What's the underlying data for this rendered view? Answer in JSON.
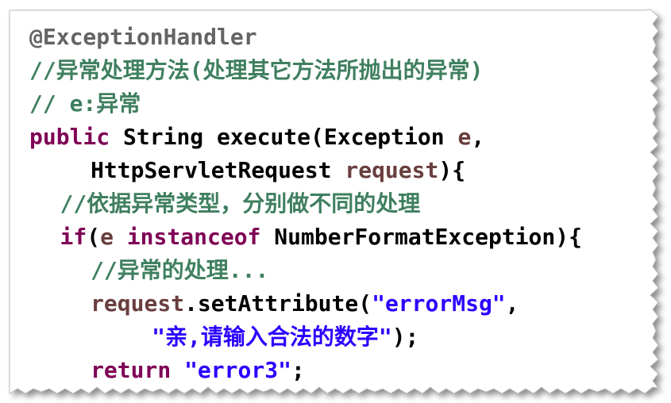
{
  "code": {
    "lines": [
      {
        "indent": 0,
        "tokens": [
          {
            "t": "@ExceptionHandler",
            "c": "annotation"
          }
        ]
      },
      {
        "indent": 0,
        "tokens": [
          {
            "t": "//异常处理方法(处理其它方法所抛出的异常)",
            "c": "comment"
          }
        ]
      },
      {
        "indent": 0,
        "tokens": [
          {
            "t": "// e:异常",
            "c": "comment"
          }
        ]
      },
      {
        "indent": 0,
        "tokens": [
          {
            "t": "public",
            "c": "keyword"
          },
          {
            "t": " String execute(Exception ",
            "c": "type"
          },
          {
            "t": "e",
            "c": "param"
          },
          {
            "t": ",",
            "c": "plain"
          }
        ]
      },
      {
        "indent": 4,
        "tokens": [
          {
            "t": "HttpServletRequest ",
            "c": "type"
          },
          {
            "t": "request",
            "c": "param"
          },
          {
            "t": "){",
            "c": "plain"
          }
        ]
      },
      {
        "indent": 2,
        "tokens": [
          {
            "t": "//依据异常类型，分别做不同的处理",
            "c": "comment"
          }
        ]
      },
      {
        "indent": 2,
        "tokens": [
          {
            "t": "if",
            "c": "keyword"
          },
          {
            "t": "(",
            "c": "plain"
          },
          {
            "t": "e",
            "c": "param"
          },
          {
            "t": " ",
            "c": "plain"
          },
          {
            "t": "instanceof",
            "c": "keyword"
          },
          {
            "t": " NumberFormatException){",
            "c": "type"
          }
        ]
      },
      {
        "indent": 4,
        "tokens": [
          {
            "t": "//异常的处理...",
            "c": "comment"
          }
        ]
      },
      {
        "indent": 4,
        "tokens": [
          {
            "t": "request",
            "c": "param"
          },
          {
            "t": ".setAttribute(",
            "c": "plain"
          },
          {
            "t": "\"errorMsg\"",
            "c": "string"
          },
          {
            "t": ",",
            "c": "plain"
          }
        ]
      },
      {
        "indent": 8,
        "tokens": [
          {
            "t": "\"亲,请输入合法的数字\"",
            "c": "string"
          },
          {
            "t": ");",
            "c": "plain"
          }
        ]
      },
      {
        "indent": 4,
        "tokens": [
          {
            "t": "return",
            "c": "keyword"
          },
          {
            "t": " ",
            "c": "plain"
          },
          {
            "t": "\"error3\"",
            "c": "string"
          },
          {
            "t": ";",
            "c": "plain"
          }
        ]
      }
    ]
  },
  "colors": {
    "annotation": "#646464",
    "comment": "#3f7f5f",
    "keyword": "#7f0055",
    "type": "#000000",
    "param": "#6a3e3e",
    "plain": "#000000",
    "string": "#2a00ff"
  }
}
